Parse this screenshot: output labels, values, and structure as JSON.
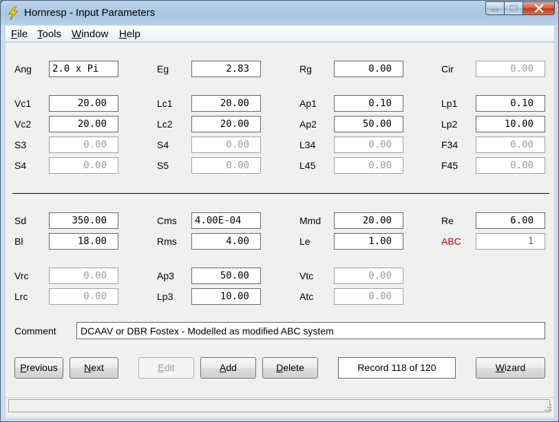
{
  "window": {
    "title": "Hornresp - Input Parameters"
  },
  "menu": [
    {
      "u": "F",
      "rest": "ile"
    },
    {
      "u": "T",
      "rest": "ools"
    },
    {
      "u": "W",
      "rest": "indow"
    },
    {
      "u": "H",
      "rest": "elp"
    }
  ],
  "params": {
    "Ang": "2.0 x Pi",
    "Eg": "2.83",
    "Rg": "0.00",
    "Cir": "0.00",
    "Vc1": "20.00",
    "Lc1": "20.00",
    "Ap1": "0.10",
    "Lp1": "0.10",
    "Vc2": "20.00",
    "Lc2": "20.00",
    "Ap2": "50.00",
    "Lp2": "10.00",
    "S3": "0.00",
    "S4": "0.00",
    "L34": "0.00",
    "F34": "0.00",
    "S4b": "0.00",
    "S5": "0.00",
    "L45": "0.00",
    "F45": "0.00",
    "Sd": "350.00",
    "Cms": "4.00E-04",
    "Mmd": "20.00",
    "Re": "6.00",
    "Bl": "18.00",
    "Rms": "4.00",
    "Le": "1.00",
    "ABC": "1",
    "Vrc": "0.00",
    "Ap3": "50.00",
    "Vtc": "0.00",
    "Lrc": "0.00",
    "Lp3": "10.00",
    "Atc": "0.00"
  },
  "labels": {
    "Ang": "Ang",
    "Eg": "Eg",
    "Rg": "Rg",
    "Cir": "Cir",
    "Vc1": "Vc1",
    "Lc1": "Lc1",
    "Ap1": "Ap1",
    "Lp1": "Lp1",
    "Vc2": "Vc2",
    "Lc2": "Lc2",
    "Ap2": "Ap2",
    "Lp2": "Lp2",
    "S3": "S3",
    "S4": "S4",
    "L34": "L34",
    "F34": "F34",
    "S4b": "S4",
    "S5": "S5",
    "L45": "L45",
    "F45": "F45",
    "Sd": "Sd",
    "Cms": "Cms",
    "Mmd": "Mmd",
    "Re": "Re",
    "Bl": "Bl",
    "Rms": "Rms",
    "Le": "Le",
    "ABC": "ABC",
    "Vrc": "Vrc",
    "Ap3": "Ap3",
    "Vtc": "Vtc",
    "Lrc": "Lrc",
    "Lp3": "Lp3",
    "Atc": "Atc"
  },
  "comment": {
    "label": "Comment",
    "value": "DCAAV or DBR Fostex - Modelled as modified ABC system"
  },
  "buttons": {
    "previous": {
      "u": "P",
      "rest": "revious"
    },
    "next": {
      "u": "N",
      "rest": "ext"
    },
    "edit": {
      "u": "E",
      "rest": "dit"
    },
    "add": {
      "u": "A",
      "rest": "dd"
    },
    "delete": {
      "u": "D",
      "rest": "elete"
    },
    "wizard": {
      "u": "W",
      "rest": "izard"
    }
  },
  "record": "Record 118 of 120",
  "colors": {
    "accent_label": "#c00000",
    "title_gradient": "#a9c6e3",
    "close_button": "#c03a1c"
  }
}
